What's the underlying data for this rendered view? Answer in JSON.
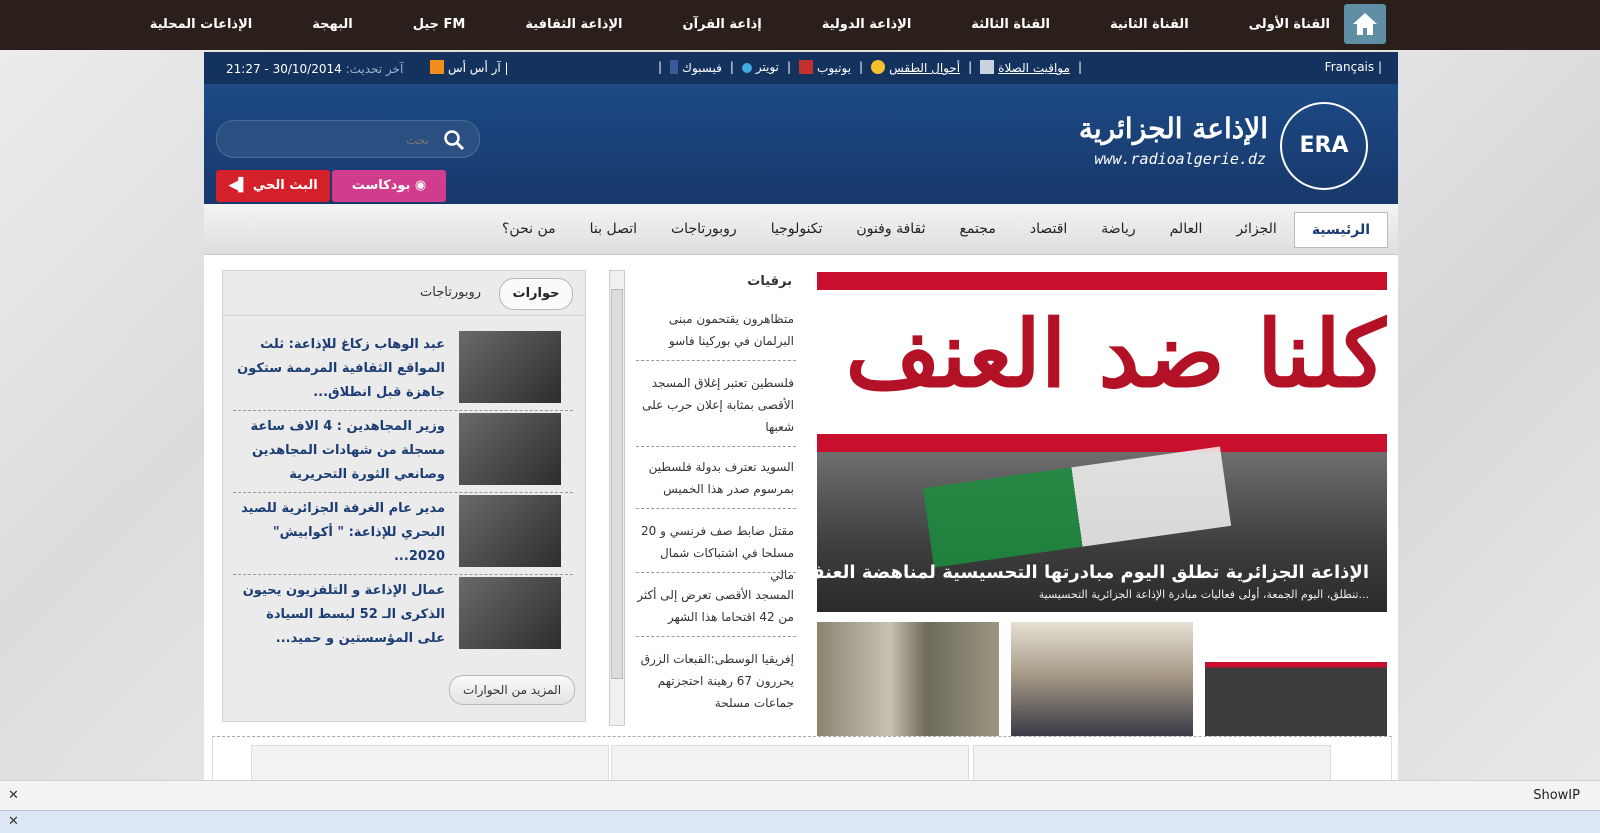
{
  "topnav": [
    "القناة الأولى",
    "القناة الثانية",
    "القناة الثالثة",
    "الإذاعة الدولية",
    "إذاعة القرآن",
    "الإذاعة الثقافية",
    "جيل FM",
    "البهجة",
    "الإذاعات المحلية"
  ],
  "infobar": {
    "francais": "Français",
    "prayer": "مواقيت الصلاة",
    "weather": "أحوال الطقس",
    "youtube": "يوتيوب",
    "twitter": "تويتر",
    "facebook": "فيسبوك",
    "rss": "آر أس أس",
    "update_label": "آخر تحديث:",
    "update_value": "30/10/2014 - 21:27"
  },
  "header": {
    "logo_text": "الإذاعة الجزائرية",
    "logo_url": "www.radioalgerie.dz",
    "emblem": "ERA",
    "search_placeholder": "بحث",
    "live_label": "البث الحي",
    "podcast_label": "بودكاست"
  },
  "mainnav": [
    "الرئيسية",
    "الجزائر",
    "العالم",
    "رياضة",
    "اقتصاد",
    "مجتمع",
    "ثقافة وفنون",
    "تكنولوجيا",
    "روبورتاجات",
    "اتصل بنا",
    "من نحن؟"
  ],
  "slider": {
    "banner_text": "كلنا ضد العنف",
    "caption": "الإذاعة الجزائرية تطلق اليوم مبادرتها التحسيسية لمناهضة العنف في الملاعب",
    "sub": "تنطلق، اليوم الجمعة، أولى فعاليات مبادرة الإذاعة الجزائرية التحسيسية..."
  },
  "news": {
    "title": "برقيات",
    "items": [
      "متظاهرون يقتحمون مبنى البرلمان في بوركينا فاسو",
      "فلسطين تعتبر إغلاق المسجد الأقصى بمثابة إعلان حرب على شعبها",
      "السويد تعترف بدولة فلسطين بمرسوم صدر هذا الخميس",
      "مقتل ضابط صف فرنسي و 20 مسلحا في اشتباكات شمال مالي",
      "المسجد الأقصى تعرض إلى أكثر من 42 اقتحاما هذا الشهر",
      "إفريقيا الوسطى:القبعات الزرق يحررون 67 رهينة احتجزتهم جماعات مسلحة"
    ]
  },
  "leftbox": {
    "tab_active": "حوارات",
    "tab_other": "روبورتاجات",
    "articles": [
      "عبد الوهاب زكاغ للإذاعة: ثلث المواقع الثقافية المرممة ستكون جاهزة قبل انطلاق...",
      "وزير المجاهدين : 4 الاف ساعة مسجلة من شهادات المجاهدين وصانعي الثورة التحريرية",
      "مدير عام الغرفة الجزائرية للصيد البحري للإذاعة: \" أكوابيش\" 2020...",
      "عمال الإذاعة و التلفزيون يحيون الذكرى الـ 52 لبسط السيادة على المؤسستين و حميد..."
    ],
    "more": "المزيد من الحوارات"
  },
  "statusbar": {
    "showip": "ShowIP",
    "close": "✕"
  },
  "colors": {
    "topbar": "#2a1f1a",
    "header": "#17386a",
    "live": "#d4202a",
    "podcast": "#d23c8d",
    "link": "#1b3d73"
  }
}
